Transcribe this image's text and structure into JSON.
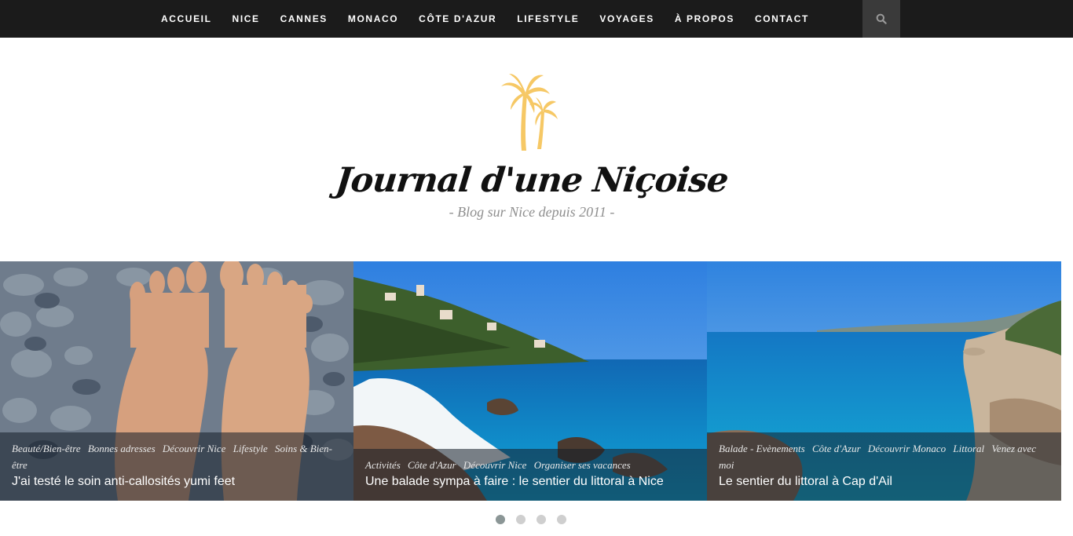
{
  "nav": {
    "items": [
      "ACCUEIL",
      "NICE",
      "CANNES",
      "MONACO",
      "CÔTE D'AZUR",
      "LIFESTYLE",
      "VOYAGES",
      "À PROPOS",
      "CONTACT"
    ],
    "search_icon": "search-icon"
  },
  "brand": {
    "logo_icon": "palm-trees-icon",
    "title": "Journal d'une Niçoise",
    "tagline": "- Blog sur Nice depuis 2011 -",
    "logo_color": "#f6c865"
  },
  "slides": [
    {
      "categories": [
        "Beauté/Bien-être",
        "Bonnes adresses",
        "Découvrir Nice",
        "Lifestyle",
        "Soins & Bien-être"
      ],
      "title": "J'ai testé le soin anti-callosités yumi feet"
    },
    {
      "categories": [
        "Activités",
        "Côte d'Azur",
        "Découvrir Nice",
        "Organiser ses vacances"
      ],
      "title": "Une balade sympa à faire : le sentier du littoral à Nice"
    },
    {
      "categories": [
        "Balade - Evènements",
        "Côte d'Azur",
        "Découvrir Monaco",
        "Littoral",
        "Venez avec moi"
      ],
      "title": "Le sentier du littoral à Cap d'Ail"
    }
  ],
  "pager": {
    "count": 4,
    "active": 1
  },
  "colors": {
    "nav_bg": "#1b1b1b",
    "search_bg": "#3a3a3a",
    "dot_active": "#8b9696",
    "dot": "#cfcfcf"
  }
}
